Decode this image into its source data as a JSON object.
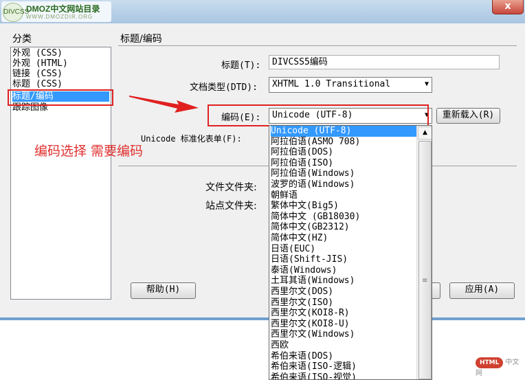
{
  "window": {
    "logo_badge": "DIVCSS",
    "logo_title": "DMOZ中文网站目录",
    "logo_url": "WWW.DMOZDIR.ORG",
    "close_glyph": "x"
  },
  "categories": {
    "header": "分类",
    "items": [
      {
        "label": "外观 (CSS)"
      },
      {
        "label": "外观 (HTML)"
      },
      {
        "label": "链接 (CSS)"
      },
      {
        "label": "标题 (CSS)"
      },
      {
        "label": "标题/编码",
        "selected": true
      },
      {
        "label": "跟踪图像"
      }
    ]
  },
  "section": {
    "title": "标题/编码",
    "title_label": "标题(T):",
    "title_value": "DIVCSS5编码",
    "doctype_label": "文档类型(DTD):",
    "doctype_value": "XHTML 1.0 Transitional",
    "encoding_label": "编码(E):",
    "encoding_value": "Unicode (UTF-8)",
    "reload_button": "重新载入(R)",
    "normalize_label": "Unicode 标准化表单(F):",
    "doc_folder_label": "文件文件夹:",
    "site_folder_label": "站点文件夹:"
  },
  "annotation": {
    "text": "编码选择 需要编码",
    "color": "#e03030"
  },
  "buttons": {
    "help": "帮助(H)",
    "apply": "应用(A)"
  },
  "encoding_options": [
    {
      "label": "Unicode (UTF-8)",
      "selected": true
    },
    {
      "label": "阿拉伯语(ASMO 708)"
    },
    {
      "label": "阿拉伯语(DOS)"
    },
    {
      "label": "阿拉伯语(ISO)"
    },
    {
      "label": "阿拉伯语(Windows)"
    },
    {
      "label": "波罗的语(Windows)"
    },
    {
      "label": "朝鲜语"
    },
    {
      "label": "繁体中文(Big5)"
    },
    {
      "label": "简体中文 (GB18030)"
    },
    {
      "label": "简体中文(GB2312)"
    },
    {
      "label": "简体中文(HZ)"
    },
    {
      "label": "日语(EUC)"
    },
    {
      "label": "日语(Shift-JIS)"
    },
    {
      "label": "泰语(Windows)"
    },
    {
      "label": "土耳其语(Windows)"
    },
    {
      "label": "西里尔文(DOS)"
    },
    {
      "label": "西里尔文(ISO)"
    },
    {
      "label": "西里尔文(KOI8-R)"
    },
    {
      "label": "西里尔文(KOI8-U)"
    },
    {
      "label": "西里尔文(Windows)"
    },
    {
      "label": "西欧"
    },
    {
      "label": "希伯来语(DOS)"
    },
    {
      "label": "希伯来语(ISO-逻辑)"
    },
    {
      "label": "希伯来语(ISO-视觉)"
    }
  ],
  "watermark": {
    "badge": "HTML",
    "text": "中文网"
  },
  "colors": {
    "selection": "#3399ff",
    "highlight_box": "#e02020"
  }
}
